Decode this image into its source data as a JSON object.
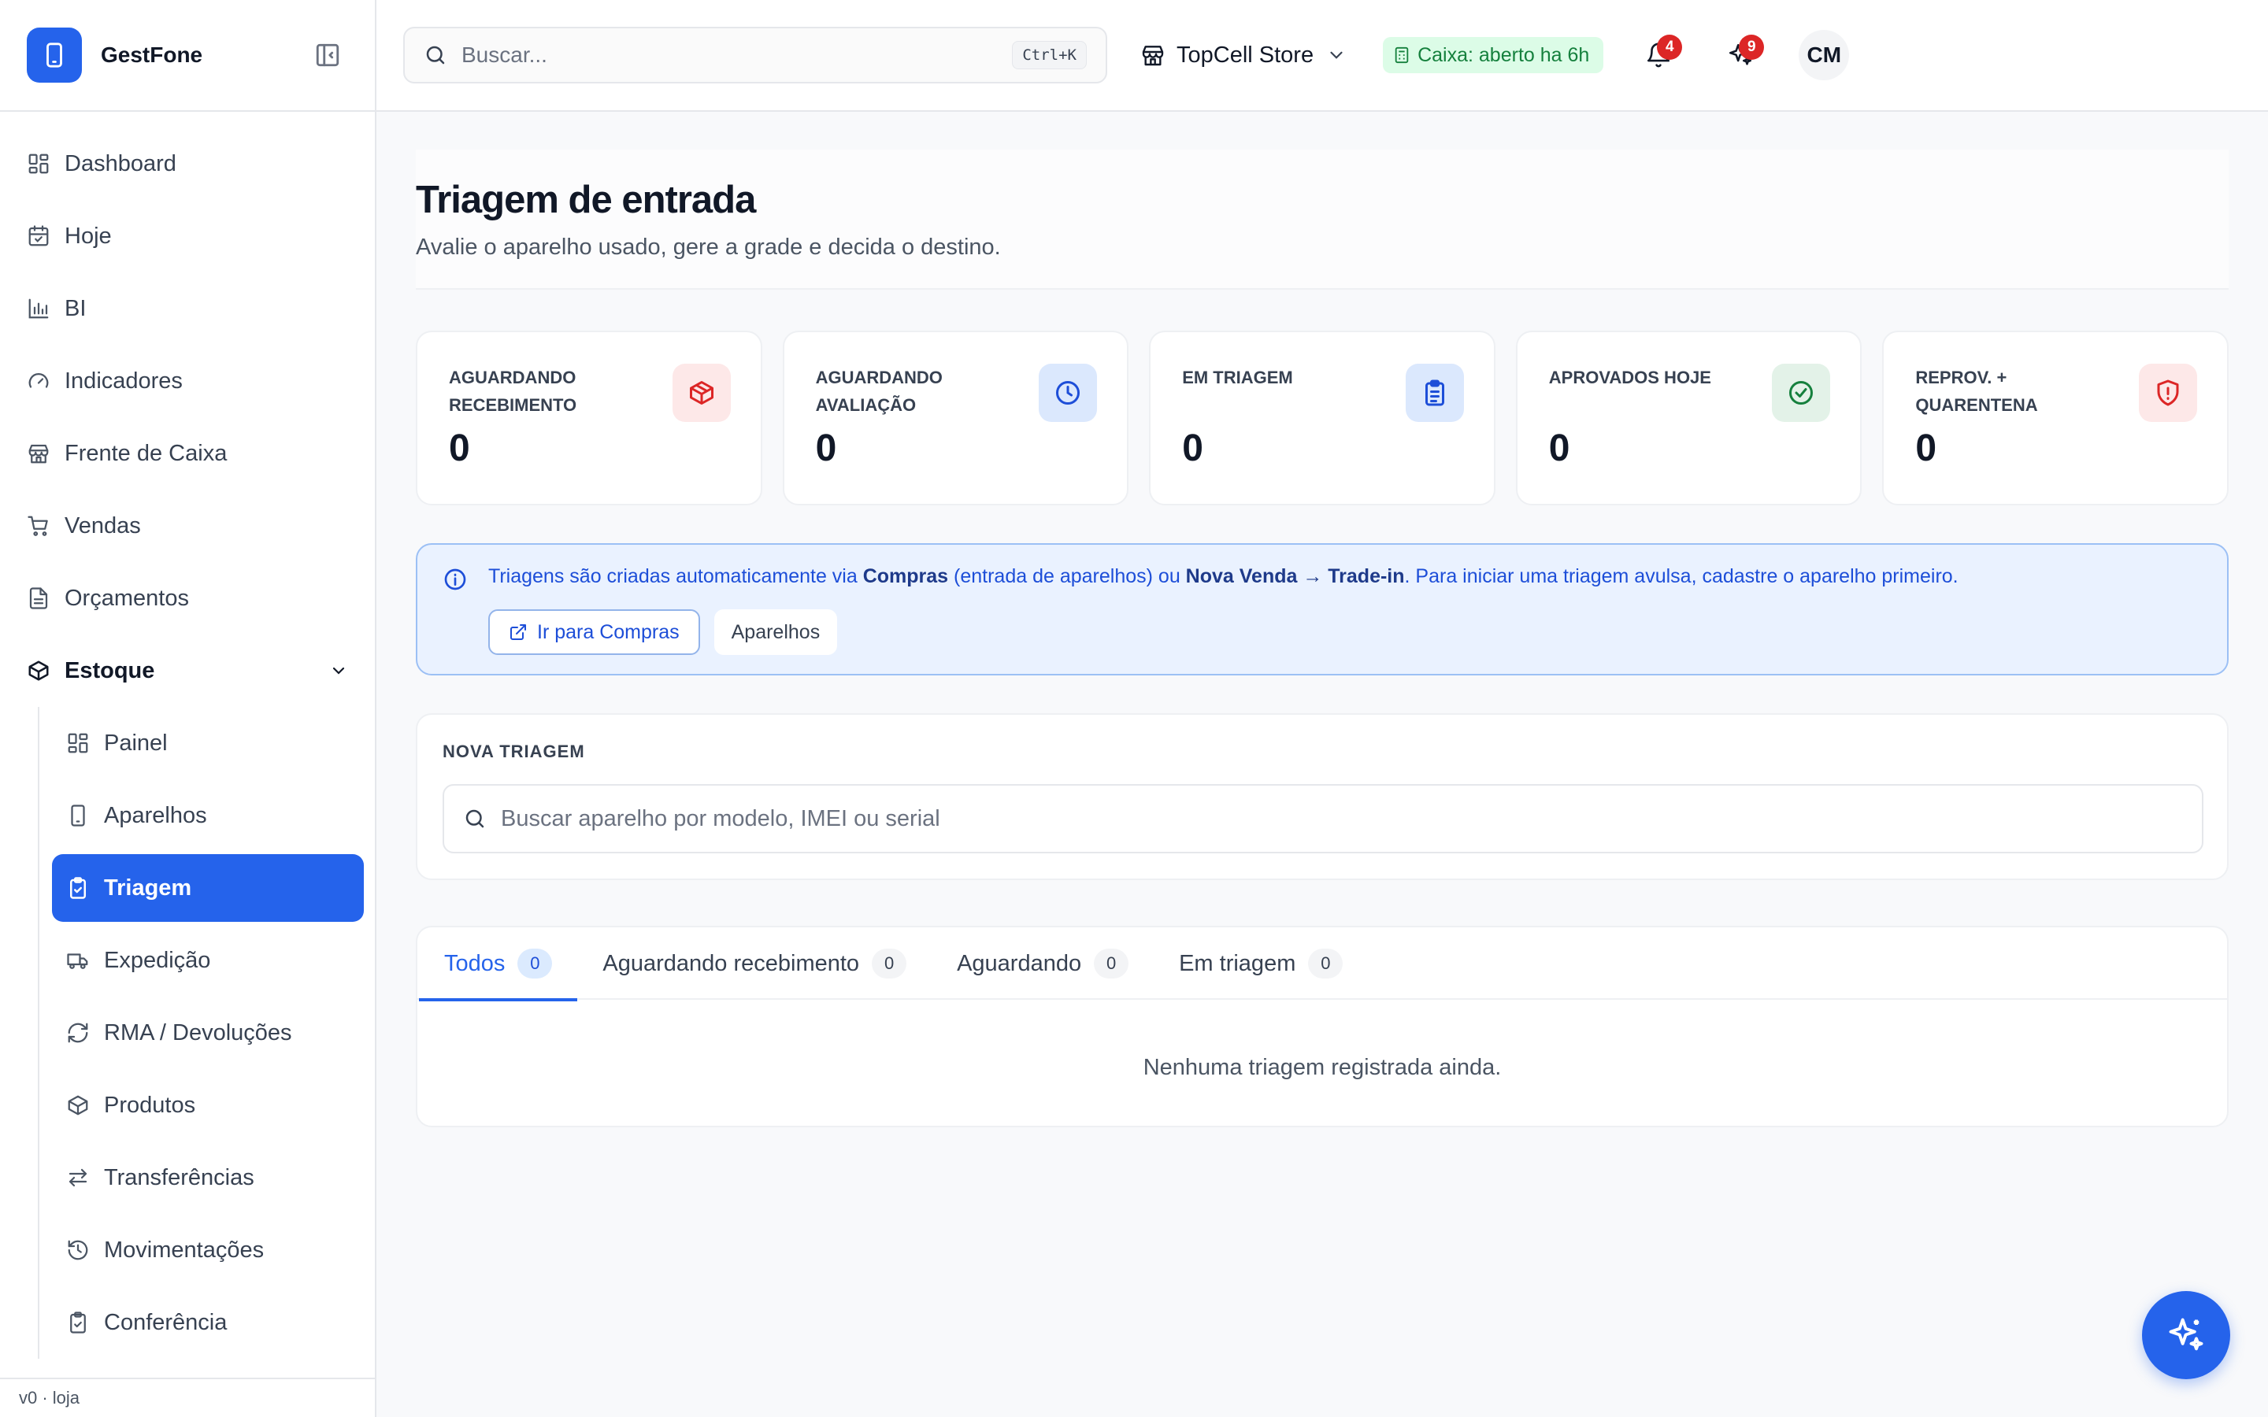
{
  "brand": {
    "name": "GestFone"
  },
  "sidebar": {
    "items": [
      {
        "label": "Dashboard",
        "icon": "dashboard-icon"
      },
      {
        "label": "Hoje",
        "icon": "calendar-icon"
      },
      {
        "label": "BI",
        "icon": "bar-chart-icon"
      },
      {
        "label": "Indicadores",
        "icon": "gauge-icon"
      },
      {
        "label": "Frente de Caixa",
        "icon": "store-icon"
      },
      {
        "label": "Vendas",
        "icon": "cart-icon"
      },
      {
        "label": "Orçamentos",
        "icon": "document-icon"
      }
    ],
    "group": {
      "label": "Estoque",
      "icon": "package-icon",
      "items": [
        {
          "label": "Painel",
          "icon": "dashboard-icon"
        },
        {
          "label": "Aparelhos",
          "icon": "smartphone-icon"
        },
        {
          "label": "Triagem",
          "icon": "clipboard-check-icon",
          "active": true
        },
        {
          "label": "Expedição",
          "icon": "truck-icon"
        },
        {
          "label": "RMA / Devoluções",
          "icon": "refresh-icon"
        },
        {
          "label": "Produtos",
          "icon": "package-icon"
        },
        {
          "label": "Transferências",
          "icon": "arrows-swap-icon"
        },
        {
          "label": "Movimentações",
          "icon": "history-icon"
        },
        {
          "label": "Conferência",
          "icon": "clipboard-check-icon"
        }
      ]
    },
    "footer": "v0 · loja"
  },
  "header": {
    "search_placeholder": "Buscar...",
    "search_shortcut": "Ctrl+K",
    "store": "TopCell Store",
    "caixa_status": "Caixa: aberto ha 6h",
    "notifications_count": "4",
    "ai_count": "9",
    "user_initials": "CM"
  },
  "page": {
    "title": "Triagem de entrada",
    "subtitle": "Avalie o aparelho usado, gere a grade e decida o destino."
  },
  "stats": [
    {
      "label": "Aguardando recebimento",
      "value": "0",
      "icon": "package-icon",
      "bg": "#fde8e8",
      "color": "#dc2626"
    },
    {
      "label": "Aguardando avaliação",
      "value": "0",
      "icon": "clock-icon",
      "bg": "#dbe8fd",
      "color": "#1d4ed8"
    },
    {
      "label": "Em triagem",
      "value": "0",
      "icon": "clipboard-list-icon",
      "bg": "#dbe8fd",
      "color": "#1d4ed8"
    },
    {
      "label": "Aprovados hoje",
      "value": "0",
      "icon": "check-circle-icon",
      "bg": "#e3f2e8",
      "color": "#15803d"
    },
    {
      "label": "Reprov. + quarentena",
      "value": "0",
      "icon": "shield-alert-icon",
      "bg": "#fde8e8",
      "color": "#dc2626"
    }
  ],
  "info": {
    "text_1": "Triagens são criadas automaticamente via ",
    "bold_1": "Compras",
    "text_2": " (entrada de aparelhos) ou ",
    "bold_2": "Nova Venda → Trade-in",
    "text_3": ". Para iniciar uma triagem avulsa, cadastre o aparelho primeiro.",
    "btn_compras": "Ir para Compras",
    "btn_aparelhos": "Aparelhos"
  },
  "nova_triagem": {
    "title": "NOVA TRIAGEM",
    "placeholder": "Buscar aparelho por modelo, IMEI ou serial"
  },
  "tabs": [
    {
      "label": "Todos",
      "count": "0",
      "active": true
    },
    {
      "label": "Aguardando recebimento",
      "count": "0"
    },
    {
      "label": "Aguardando",
      "count": "0"
    },
    {
      "label": "Em triagem",
      "count": "0"
    }
  ],
  "empty_message": "Nenhuma triagem registrada ainda.",
  "colors": {
    "primary": "#2563eb",
    "success": "#15803d",
    "danger": "#dc2626"
  }
}
